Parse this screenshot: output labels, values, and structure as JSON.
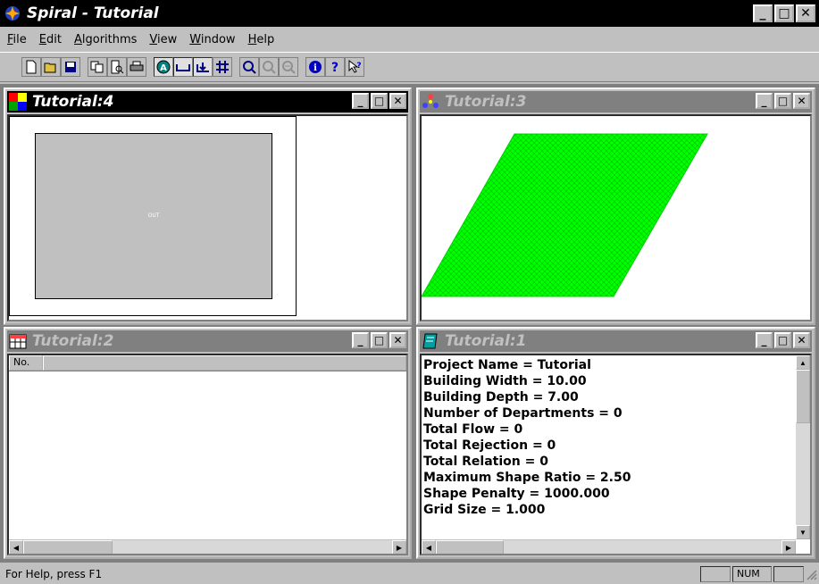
{
  "app": {
    "title": "Spiral - Tutorial",
    "window_controls": {
      "minimize": "_",
      "maximize": "□",
      "close": "✕"
    }
  },
  "menu": [
    "File",
    "Edit",
    "Algorithms",
    "View",
    "Window",
    "Help"
  ],
  "toolbar": {
    "groups": [
      [
        "new-icon",
        "open-icon",
        "save-icon"
      ],
      [
        "copy-icon",
        "print-preview-icon",
        "print-icon"
      ],
      [
        "algorithm-icon",
        "measure-icon",
        "flow-icon",
        "grid-icon"
      ],
      [
        "zoom-in-icon",
        "zoom-out-icon",
        "zoom-fit-icon"
      ],
      [
        "info-icon",
        "help-icon",
        "context-help-icon"
      ]
    ]
  },
  "windows": {
    "w4": {
      "title": "Tutorial:4",
      "out_label": "OUT"
    },
    "w3": {
      "title": "Tutorial:3",
      "fill_color": "#00ff00"
    },
    "w2": {
      "title": "Tutorial:2",
      "column_no": "No."
    },
    "w1": {
      "title": "Tutorial:1",
      "lines": [
        "Project Name = Tutorial",
        "Building Width = 10.00",
        "Building Depth = 7.00",
        "Number of Departments = 0",
        "Total Flow = 0",
        "Total Rejection = 0",
        "Total Relation = 0",
        "Maximum Shape Ratio = 2.50",
        "Shape Penalty = 1000.000",
        "Grid Size = 1.000"
      ]
    }
  },
  "status": {
    "help": "For Help, press F1",
    "num": "NUM"
  }
}
